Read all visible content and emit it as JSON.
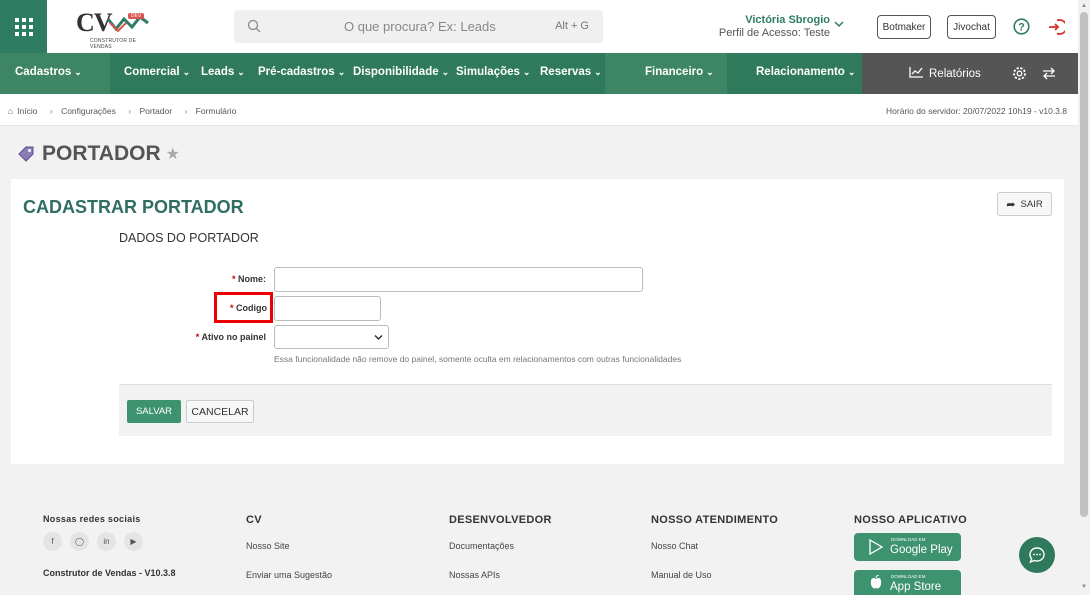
{
  "header": {
    "logo_text": "CV",
    "logo_badge": "DEV",
    "logo_sub": "CONSTRUTOR DE VENDAS",
    "search_placeholder": "O que procura? Ex: Leads",
    "search_shortcut": "Alt + G",
    "user_name": "Victória Sbrogio",
    "user_profile": "Perfil de Acesso: Teste",
    "botmaker_label": "Botmaker",
    "jivochat_label": "Jivochat"
  },
  "nav": {
    "items": [
      "Cadastros",
      "Comercial",
      "Leads",
      "Pré-cadastros",
      "Disponibilidade",
      "Simulações",
      "Reservas",
      "Financeiro",
      "Relacionamento"
    ],
    "reports_label": "Relatórios"
  },
  "breadcrumb": {
    "items": [
      "Início",
      "Configurações",
      "Portador",
      "Formulário"
    ],
    "server_time": "Horário do servidor: 20/07/2022 10h19 - v10.3.8"
  },
  "page": {
    "title": "PORTADOR",
    "form_title": "CADASTRAR PORTADOR",
    "exit_label": "SAIR",
    "section_title": "DADOS DO PORTADOR",
    "fields": {
      "nome_label": "Nome:",
      "nome_value": "",
      "codigo_label": "Codigo",
      "codigo_value": "",
      "ativo_label": "Ativo no painel",
      "ativo_value": ""
    },
    "required_mark": "*",
    "hint": "Essa funcionalidade não remove do painel, somente oculta em relacionamentos com outras funcionalidades",
    "save_label": "SALVAR",
    "cancel_label": "CANCELAR"
  },
  "footer": {
    "social_title": "Nossas redes sociais",
    "company": "Construtor de Vendas - V10.3.8",
    "cv_title": "CV",
    "cv_links": [
      "Nosso Site",
      "Enviar uma Sugestão"
    ],
    "dev_title": "DESENVOLVEDOR",
    "dev_links": [
      "Documentações",
      "Nossas APIs"
    ],
    "support_title": "NOSSO ATENDIMENTO",
    "support_links": [
      "Nosso Chat",
      "Manual de Uso"
    ],
    "app_title": "NOSSO APLICATIVO",
    "google_small": "DOWNLOAD EM",
    "google_big": "Google Play",
    "apple_small": "DOWNLOAD EM",
    "apple_big": "App Store"
  },
  "colors": {
    "brand_green": "#2e7d62",
    "nav_green": "#3d8564",
    "highlight_red": "#e00000"
  }
}
